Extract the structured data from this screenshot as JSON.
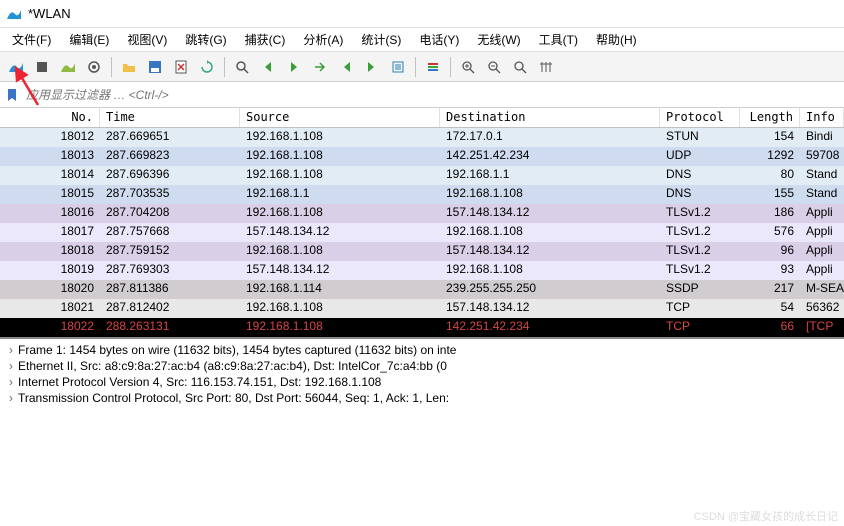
{
  "window": {
    "title": "*WLAN"
  },
  "menu": {
    "file": "文件(F)",
    "edit": "编辑(E)",
    "view": "视图(V)",
    "goto": "跳转(G)",
    "capture": "捕获(C)",
    "analyze": "分析(A)",
    "statistics": "统计(S)",
    "telephony": "电话(Y)",
    "wireless": "无线(W)",
    "tools": "工具(T)",
    "help": "帮助(H)"
  },
  "filter": {
    "placeholder": "应用显示过滤器 … <Ctrl-/>"
  },
  "columns": {
    "no": "No.",
    "time": "Time",
    "source": "Source",
    "destination": "Destination",
    "protocol": "Protocol",
    "length": "Length",
    "info": "Info"
  },
  "packets": [
    {
      "no": "18012",
      "time": "287.669651",
      "src": "192.168.1.108",
      "dst": "172.17.0.1",
      "proto": "STUN",
      "len": "154",
      "info": "Bindi",
      "bg": "e2ecf5"
    },
    {
      "no": "18013",
      "time": "287.669823",
      "src": "192.168.1.108",
      "dst": "142.251.42.234",
      "proto": "UDP",
      "len": "1292",
      "info": "59708",
      "bg": "cfdcf0"
    },
    {
      "no": "18014",
      "time": "287.696396",
      "src": "192.168.1.108",
      "dst": "192.168.1.1",
      "proto": "DNS",
      "len": "80",
      "info": "Stand",
      "bg": "e2ecf5"
    },
    {
      "no": "18015",
      "time": "287.703535",
      "src": "192.168.1.1",
      "dst": "192.168.1.108",
      "proto": "DNS",
      "len": "155",
      "info": "Stand",
      "bg": "cfdcf0"
    },
    {
      "no": "18016",
      "time": "287.704208",
      "src": "192.168.1.108",
      "dst": "157.148.134.12",
      "proto": "TLSv1.2",
      "len": "186",
      "info": "Appli",
      "bg": "dad0e8"
    },
    {
      "no": "18017",
      "time": "287.757668",
      "src": "157.148.134.12",
      "dst": "192.168.1.108",
      "proto": "TLSv1.2",
      "len": "576",
      "info": "Appli",
      "bg": "eae8fa"
    },
    {
      "no": "18018",
      "time": "287.759152",
      "src": "192.168.1.108",
      "dst": "157.148.134.12",
      "proto": "TLSv1.2",
      "len": "96",
      "info": "Appli",
      "bg": "dad0e8"
    },
    {
      "no": "18019",
      "time": "287.769303",
      "src": "157.148.134.12",
      "dst": "192.168.1.108",
      "proto": "TLSv1.2",
      "len": "93",
      "info": "Appli",
      "bg": "eae8fa"
    },
    {
      "no": "18020",
      "time": "287.811386",
      "src": "192.168.1.114",
      "dst": "239.255.255.250",
      "proto": "SSDP",
      "len": "217",
      "info": "M-SEA",
      "bg": "cfcace"
    },
    {
      "no": "18021",
      "time": "287.812402",
      "src": "192.168.1.108",
      "dst": "157.148.134.12",
      "proto": "TCP",
      "len": "54",
      "info": "56362",
      "bg": "e9e8e8"
    },
    {
      "no": "18022",
      "time": "288.263131",
      "src": "192.168.1.108",
      "dst": "142.251.42.234",
      "proto": "TCP",
      "len": "66",
      "info": "[TCP",
      "bg": "black"
    }
  ],
  "details": {
    "l1": "Frame 1: 1454 bytes on wire (11632 bits), 1454 bytes captured (11632 bits) on inte",
    "l2": "Ethernet II, Src: a8:c9:8a:27:ac:b4 (a8:c9:8a:27:ac:b4), Dst: IntelCor_7c:a4:bb (0",
    "l3": "Internet Protocol Version 4, Src: 116.153.74.151, Dst: 192.168.1.108",
    "l4": "Transmission Control Protocol, Src Port: 80, Dst Port: 56044, Seq: 1, Ack: 1, Len:"
  },
  "watermark": "CSDN @宝藏女孩的成长日记"
}
